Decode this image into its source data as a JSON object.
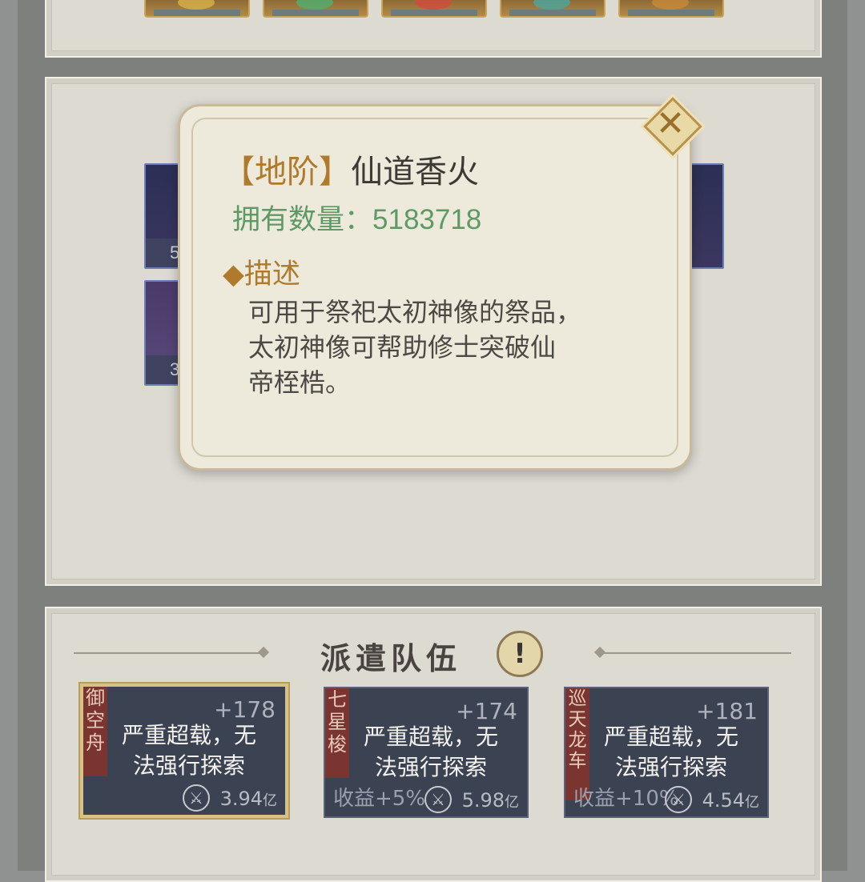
{
  "top_slots": [
    {
      "color": "#d8b24a"
    },
    {
      "color": "#4fb070"
    },
    {
      "color": "#d24b3c"
    },
    {
      "color": "#4aa8a0"
    },
    {
      "color": "#c88a3a"
    }
  ],
  "background_items": [
    {
      "count": "5"
    },
    {
      "count": "3"
    }
  ],
  "popup": {
    "rank": "【地阶】",
    "name": "仙道香火",
    "count_label": "拥有数量：",
    "count_value": "5183718",
    "desc_heading": "◆描述",
    "desc_lines": [
      "可用于祭祀太初神像的祭品，",
      "太初神像可帮助修士突破仙",
      "帝桎梏。"
    ],
    "close_icon": "close-icon"
  },
  "team": {
    "title": "派遣队伍",
    "warn_symbol": "!",
    "cards": [
      {
        "tag": "御空舟",
        "plus": "+178",
        "msg1": "严重超载，无",
        "msg2": "法强行探索",
        "income": "",
        "total": "3.94",
        "unit": "亿",
        "selected": true
      },
      {
        "tag": "七星梭",
        "plus": "+174",
        "msg1": "严重超载，无",
        "msg2": "法强行探索",
        "income": "收益+5%",
        "total": "5.98",
        "unit": "亿",
        "selected": false
      },
      {
        "tag": "巡天龙车",
        "plus": "+181",
        "msg1": "严重超载，无",
        "msg2": "法强行探索",
        "income": "收益+10%",
        "total": "4.54",
        "unit": "亿",
        "selected": false
      }
    ]
  }
}
